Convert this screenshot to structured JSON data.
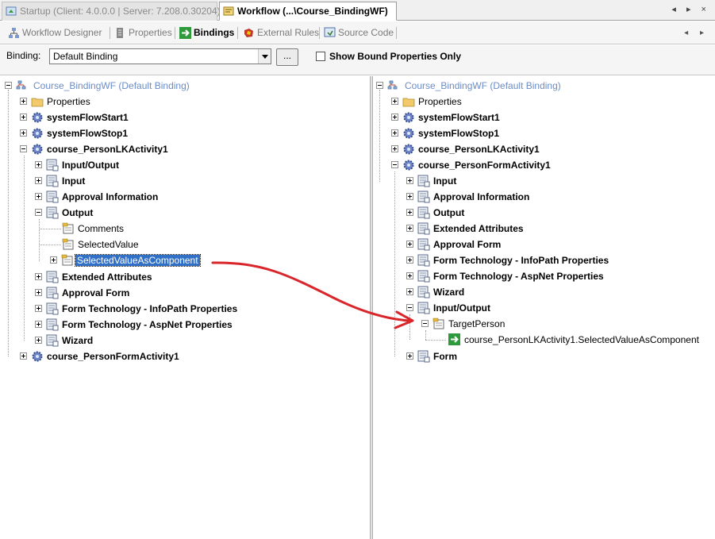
{
  "doc_tabs": {
    "startup": "Startup (Client: 4.0.0.0 | Server: 7.208.0.30204)",
    "workflow": "Workflow (...\\Course_BindingWF)",
    "controls": "◂ ▸ ×"
  },
  "view_tabs": {
    "designer": "Workflow Designer",
    "properties": "Properties",
    "bindings": "Bindings",
    "external_rules": "External Rules",
    "source_code": "Source Code",
    "nav": "◂ ▸"
  },
  "binding_bar": {
    "label": "Binding:",
    "value": "Default Binding",
    "ellipsis": "...",
    "show_bound_label": "Show Bound Properties Only"
  },
  "left_tree": {
    "root": "Course_BindingWF (Default Binding)",
    "properties": "Properties",
    "start": "systemFlowStart1",
    "stop": "systemFlowStop1",
    "lk_activity": "course_PersonLKActivity1",
    "lk_children": {
      "io": "Input/Output",
      "input": "Input",
      "approval_info": "Approval Information",
      "output": "Output",
      "comments": "Comments",
      "selected_value": "SelectedValue",
      "selected_value_component": "SelectedValueAsComponent",
      "ext_attrs": "Extended Attributes",
      "approval_form": "Approval Form",
      "ft_infopath": "Form Technology - InfoPath Properties",
      "ft_aspnet": "Form Technology - AspNet Properties",
      "wizard": "Wizard"
    },
    "form_activity": "course_PersonFormActivity1"
  },
  "right_tree": {
    "root": "Course_BindingWF (Default Binding)",
    "properties": "Properties",
    "start": "systemFlowStart1",
    "stop": "systemFlowStop1",
    "lk_activity": "course_PersonLKActivity1",
    "form_activity": "course_PersonFormActivity1",
    "form_children": {
      "input": "Input",
      "approval_info": "Approval Information",
      "output": "Output",
      "ext_attrs": "Extended Attributes",
      "approval_form": "Approval Form",
      "ft_infopath": "Form Technology - InfoPath Properties",
      "ft_aspnet": "Form Technology - AspNet Properties",
      "wizard": "Wizard",
      "io": "Input/Output",
      "target_person": "TargetPerson",
      "binding_value": "course_PersonLKActivity1.SelectedValueAsComponent",
      "form": "Form"
    }
  },
  "colors": {
    "selection": "#3170c7",
    "root_text": "#6b8cc9",
    "arrow": "#d9262a"
  }
}
